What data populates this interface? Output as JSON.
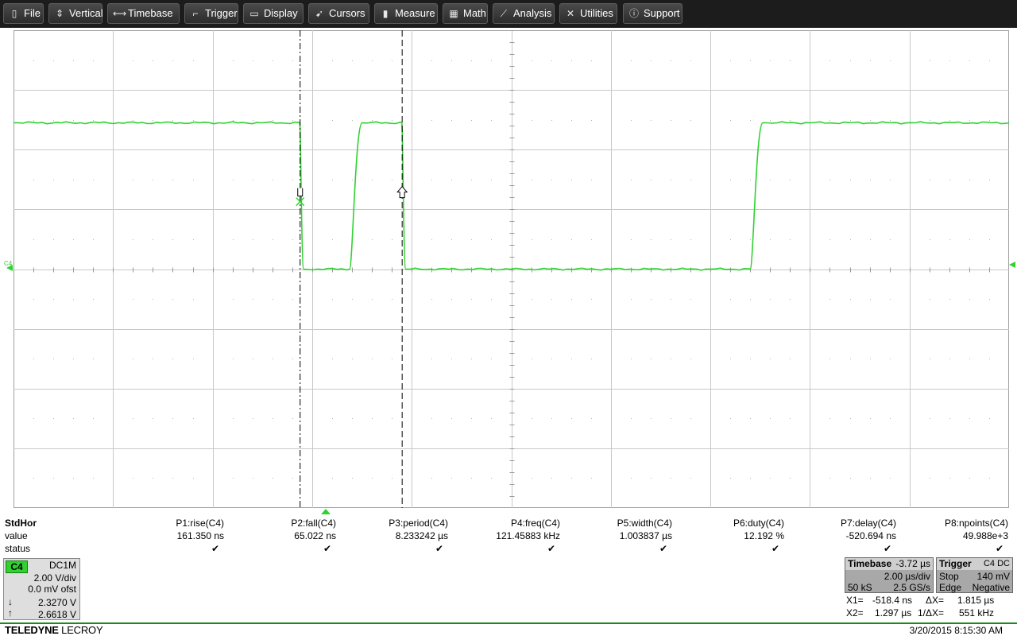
{
  "menu": [
    {
      "label": "File",
      "icon": "file-icon",
      "glyph": "▯"
    },
    {
      "label": "Vertical",
      "icon": "vertical-arrows-icon",
      "glyph": "⇕"
    },
    {
      "label": "Timebase",
      "icon": "horizontal-arrows-icon",
      "glyph": "⟷"
    },
    {
      "label": "Trigger",
      "icon": "trigger-edge-icon",
      "glyph": "⌐"
    },
    {
      "label": "Display",
      "icon": "display-icon",
      "glyph": "▭"
    },
    {
      "label": "Cursors",
      "icon": "cursor-icon",
      "glyph": "➹"
    },
    {
      "label": "Measure",
      "icon": "measure-icon",
      "glyph": "▮"
    },
    {
      "label": "Math",
      "icon": "calculator-icon",
      "glyph": "▦"
    },
    {
      "label": "Analysis",
      "icon": "analysis-chart-icon",
      "glyph": "⟋"
    },
    {
      "label": "Utilities",
      "icon": "tools-icon",
      "glyph": "✕"
    },
    {
      "label": "Support",
      "icon": "info-icon",
      "glyph": "ⓘ"
    }
  ],
  "channel_marker": "C4",
  "colors": {
    "trace": "#2fd22f",
    "grid": "#c8c8c8",
    "accent_green": "#1b8a1b"
  },
  "measure": {
    "row_header": "StdHor",
    "row_value": "value",
    "row_status": "status",
    "params": [
      {
        "name": "P1:rise(C4)",
        "value": "161.350 ns",
        "status": "✔"
      },
      {
        "name": "P2:fall(C4)",
        "value": "65.022 ns",
        "status": "✔"
      },
      {
        "name": "P3:period(C4)",
        "value": "8.233242 µs",
        "status": "✔"
      },
      {
        "name": "P4:freq(C4)",
        "value": "121.45883 kHz",
        "status": "✔"
      },
      {
        "name": "P5:width(C4)",
        "value": "1.003837 µs",
        "status": "✔"
      },
      {
        "name": "P6:duty(C4)",
        "value": "12.192 %",
        "status": "✔"
      },
      {
        "name": "P7:delay(C4)",
        "value": "-520.694 ns",
        "status": "✔"
      },
      {
        "name": "P8:npoints(C4)",
        "value": "49.988e+3",
        "status": "✔"
      }
    ]
  },
  "c4": {
    "tag": "C4",
    "coupling": "DC1M",
    "vdiv": "2.00 V/div",
    "offset": "0.0 mV ofst",
    "cursor1": "2.3270 V",
    "cursor2": "2.6618 V",
    "arrow_down": "↓",
    "arrow_up": "↑"
  },
  "timebase": {
    "title": "Timebase",
    "delay": "-3.72 µs",
    "div": "2.00 µs/div",
    "samples": "50 kS",
    "rate": "2.5 GS/s"
  },
  "trigger": {
    "title": "Trigger",
    "source": "C4 DC",
    "mode": "Stop",
    "level": "140 mV",
    "type": "Edge",
    "slope": "Negative"
  },
  "cursors": {
    "x1_label": "X1=",
    "x1": "-518.4 ns",
    "dx_label": "ΔX=",
    "dx": "1.815 µs",
    "x2_label": "X2=",
    "x2": "1.297 µs",
    "inv_label": "1/ΔX=",
    "inv": "551 kHz"
  },
  "footer": {
    "brand_bold": "TELEDYNE",
    "brand_thin": "LECROY",
    "datetime": "3/20/2015 8:15:30 AM"
  },
  "waveform": {
    "high_level_div": 2.45,
    "low_level_div": 0.0,
    "segments_us": [
      {
        "t0": -10.0,
        "t1": -4.25,
        "level": "high"
      },
      {
        "t0": -4.25,
        "t1": -3.25,
        "level": "low"
      },
      {
        "t0": -3.25,
        "t1": -2.2,
        "level": "high"
      },
      {
        "t0": -2.2,
        "t1": 4.8,
        "level": "low"
      },
      {
        "t0": 4.8,
        "t1": 10.0,
        "level": "high"
      }
    ]
  }
}
